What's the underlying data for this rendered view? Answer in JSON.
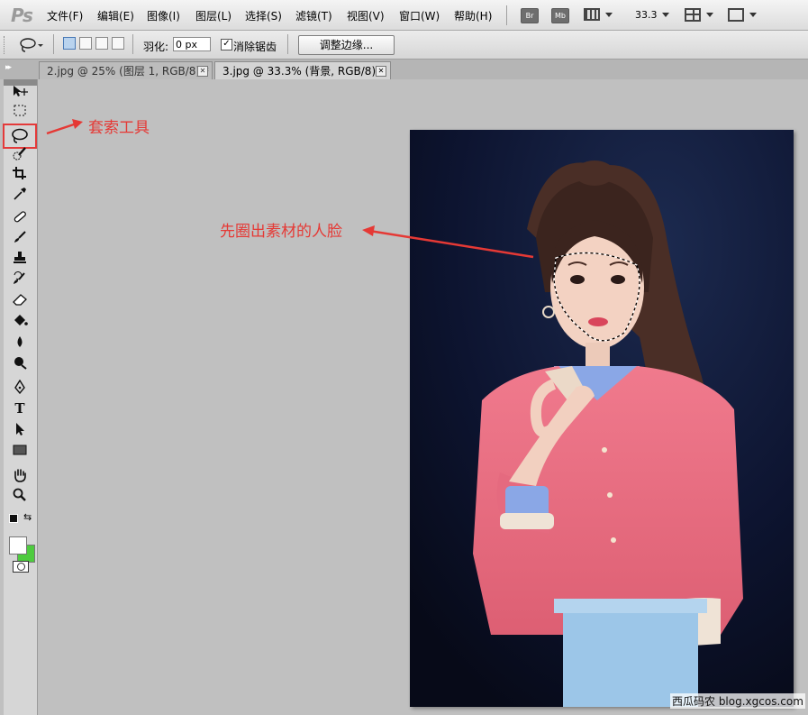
{
  "app": {
    "logo": "Ps"
  },
  "menu": [
    "文件(F)",
    "编辑(E)",
    "图像(I)",
    "图层(L)",
    "选择(S)",
    "滤镜(T)",
    "视图(V)",
    "窗口(W)",
    "帮助(H)"
  ],
  "menubar_buttons": {
    "bridge": "Br",
    "mini_bridge": "Mb",
    "zoom": "33.3"
  },
  "options_bar": {
    "feather_label": "羽化:",
    "feather_value": "0 px",
    "antialias_label": "消除锯齿",
    "antialias_checked": "☑",
    "refine_edge": "调整边缘..."
  },
  "tabs": [
    {
      "title": "2.jpg @ 25% (图层 1, RGB/8) *",
      "active": false
    },
    {
      "title": "3.jpg @ 33.3% (背景, RGB/8) *",
      "active": true
    }
  ],
  "tools": [
    {
      "name": "move-tool",
      "glyph": "▸✥"
    },
    {
      "name": "marquee-tool",
      "glyph": "⬚"
    },
    {
      "name": "lasso-tool",
      "glyph": "ℓ",
      "selected": true
    },
    {
      "name": "quick-selection-tool",
      "glyph": "✎"
    },
    {
      "name": "crop-tool",
      "glyph": "⌗"
    },
    {
      "name": "eyedropper-tool",
      "glyph": "⌿"
    },
    {
      "name": "healing-brush-tool",
      "glyph": "✚"
    },
    {
      "name": "brush-tool",
      "glyph": "✎"
    },
    {
      "name": "clone-stamp-tool",
      "glyph": "⊥"
    },
    {
      "name": "history-brush-tool",
      "glyph": "✐"
    },
    {
      "name": "eraser-tool",
      "glyph": "▱"
    },
    {
      "name": "paint-bucket-tool",
      "glyph": "◈"
    },
    {
      "name": "blur-tool",
      "glyph": "●"
    },
    {
      "name": "dodge-tool",
      "glyph": "⬤"
    },
    {
      "name": "pen-tool",
      "glyph": "✒"
    },
    {
      "name": "type-tool",
      "glyph": "T"
    },
    {
      "name": "path-selection-tool",
      "glyph": "➤"
    },
    {
      "name": "rectangle-tool",
      "glyph": "▭"
    },
    {
      "name": "hand-tool",
      "glyph": "✋"
    },
    {
      "name": "zoom-tool",
      "glyph": "🔍"
    }
  ],
  "colors": {
    "foreground": "#ffffff",
    "background": "#4ecb3e",
    "annotation": "#e53935"
  },
  "annotations": {
    "lasso": "套索工具",
    "face": "先圈出素材的人脸"
  },
  "watermark": "西瓜码农 blog.xgcos.com"
}
